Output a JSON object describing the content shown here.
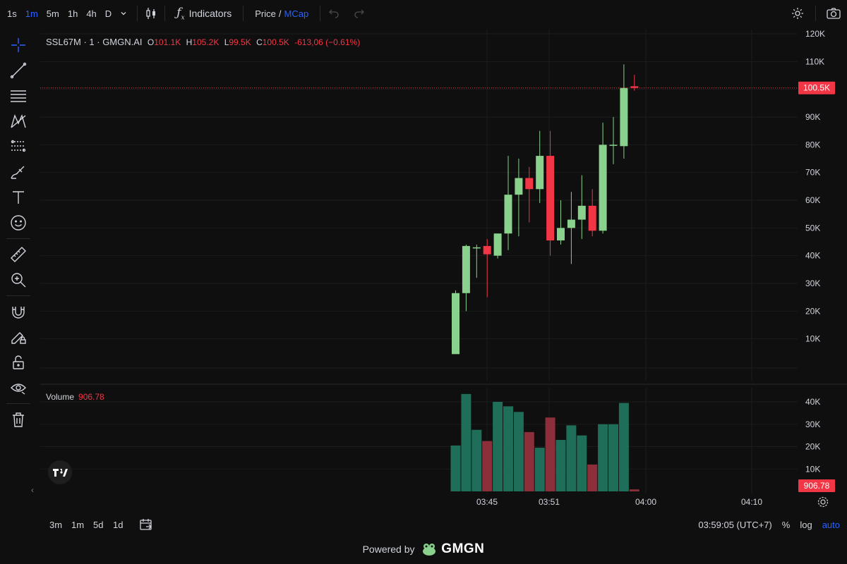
{
  "toolbar": {
    "timeframes": [
      "1s",
      "1m",
      "5m",
      "1h",
      "4h",
      "D"
    ],
    "active_timeframe": "1m",
    "indicators_label": "Indicators",
    "price_label": "Price",
    "separator": "/",
    "mcap_label": "MCap"
  },
  "legend": {
    "symbol": "SSL67M · 1 · GMGN.AI",
    "o_label": "O",
    "o_value": "101.1K",
    "h_label": "H",
    "h_value": "105.2K",
    "l_label": "L",
    "l_value": "99.5K",
    "c_label": "C",
    "c_value": "100.5K",
    "change": "-613,06 (−0.61%)"
  },
  "volume_legend": {
    "label": "Volume",
    "value": "906.78"
  },
  "price_axis": {
    "ticks": [
      "120K",
      "110K",
      "100K",
      "90K",
      "80K",
      "70K",
      "60K",
      "50K",
      "40K",
      "30K",
      "20K",
      "10K"
    ],
    "last_price_label": "100.5K"
  },
  "volume_axis": {
    "ticks": [
      "40K",
      "30K",
      "20K",
      "10K"
    ],
    "last_volume_label": "906.78"
  },
  "time_axis": {
    "ticks": [
      "03:45",
      "03:51",
      "04:00",
      "04:10"
    ]
  },
  "bottombar": {
    "ranges": [
      "3m",
      "1m",
      "5d",
      "1d"
    ],
    "clock": "03:59:05 (UTC+7)",
    "percent": "%",
    "log": "log",
    "auto": "auto"
  },
  "footer": {
    "powered_by": "Powered by",
    "brand": "GMGN"
  },
  "colors": {
    "up": "#89d18c",
    "down": "#f23645",
    "vol_up": "#1f6e5a",
    "vol_down": "#8c2f3a",
    "accent": "#2962ff"
  },
  "chart_data": {
    "type": "candlestick",
    "candles": [
      {
        "o": 4.5,
        "h": 27.5,
        "l": 4.5,
        "c": 26.5
      },
      {
        "o": 26.5,
        "h": 44,
        "l": 20,
        "c": 43.5
      },
      {
        "o": 43,
        "h": 44,
        "l": 32,
        "c": 43
      },
      {
        "o": 43.5,
        "h": 46,
        "l": 25,
        "c": 40.5
      },
      {
        "o": 40,
        "h": 46,
        "l": 39,
        "c": 48
      },
      {
        "o": 48,
        "h": 76,
        "l": 42,
        "c": 62
      },
      {
        "o": 62,
        "h": 75,
        "l": 47,
        "c": 68
      },
      {
        "o": 68,
        "h": 72,
        "l": 52,
        "c": 64
      },
      {
        "o": 64,
        "h": 85,
        "l": 59,
        "c": 76
      },
      {
        "o": 76,
        "h": 85,
        "l": 40,
        "c": 45.5
      },
      {
        "o": 45.5,
        "h": 60,
        "l": 44,
        "c": 50
      },
      {
        "o": 50,
        "h": 63,
        "l": 37,
        "c": 53
      },
      {
        "o": 53,
        "h": 69,
        "l": 46,
        "c": 58
      },
      {
        "o": 58,
        "h": 64,
        "l": 47,
        "c": 49
      },
      {
        "o": 49,
        "h": 88,
        "l": 48,
        "c": 80
      },
      {
        "o": 80,
        "h": 90,
        "l": 73,
        "c": 80
      },
      {
        "o": 79.5,
        "h": 109,
        "l": 75,
        "c": 100.5
      },
      {
        "o": 101.1,
        "h": 105.2,
        "l": 99.5,
        "c": 100.5
      }
    ],
    "volume": [
      20.5,
      43.5,
      27.5,
      22.5,
      40,
      38,
      35.5,
      26.5,
      19.5,
      33,
      23,
      29.5,
      25,
      12,
      30,
      30,
      39.5,
      0.9
    ],
    "price_ylim": [
      0,
      120
    ],
    "volume_ylim": [
      0,
      40
    ],
    "units": "K"
  }
}
